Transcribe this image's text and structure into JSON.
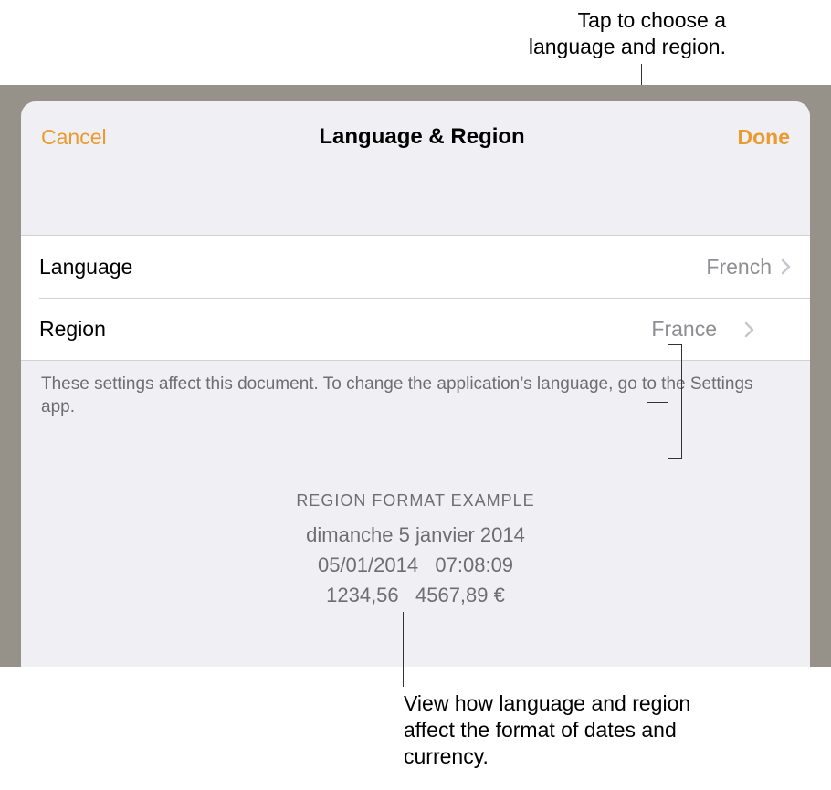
{
  "callouts": {
    "top": "Tap to choose a\nlanguage and region.",
    "bottom": "View how language and region affect the format of dates and currency."
  },
  "modal": {
    "cancel": "Cancel",
    "title": "Language & Region",
    "done": "Done",
    "rows": {
      "language": {
        "label": "Language",
        "value": "French"
      },
      "region": {
        "label": "Region",
        "value": "France"
      }
    },
    "footer": "These settings affect this document. To change the application’s language, go to the Settings app.",
    "example": {
      "header": "REGION FORMAT EXAMPLE",
      "line1": "dimanche 5 janvier 2014",
      "line2": "05/01/2014   07:08:09",
      "line3": "1234,56   4567,89 €"
    }
  },
  "colors": {
    "accent": "#ec9a2d"
  }
}
